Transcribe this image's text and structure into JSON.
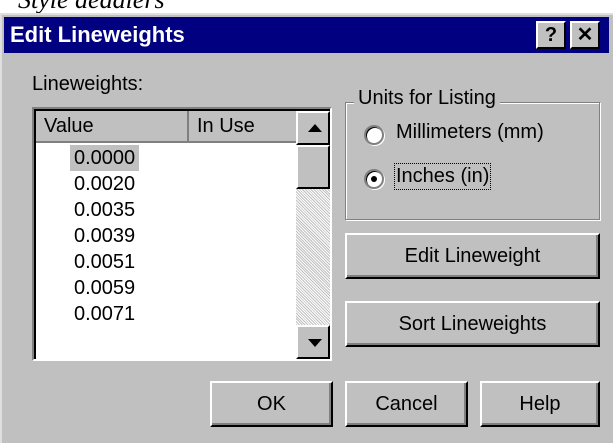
{
  "background_text": "Style deadlers",
  "dialog": {
    "title": "Edit Lineweights",
    "help_button": "?",
    "close_button": "✕"
  },
  "list": {
    "label": "Lineweights:",
    "columns": [
      "Value",
      "In Use"
    ],
    "rows": [
      "0.0000",
      "0.0020",
      "0.0035",
      "0.0039",
      "0.0051",
      "0.0059",
      "0.0071"
    ],
    "selected_index": 0
  },
  "units": {
    "group_label": "Units for Listing",
    "option_mm": "Millimeters (mm)",
    "option_in": "Inches (in)",
    "selected": "in"
  },
  "buttons": {
    "edit": "Edit Lineweight",
    "sort": "Sort Lineweights",
    "ok": "OK",
    "cancel": "Cancel",
    "help": "Help"
  }
}
